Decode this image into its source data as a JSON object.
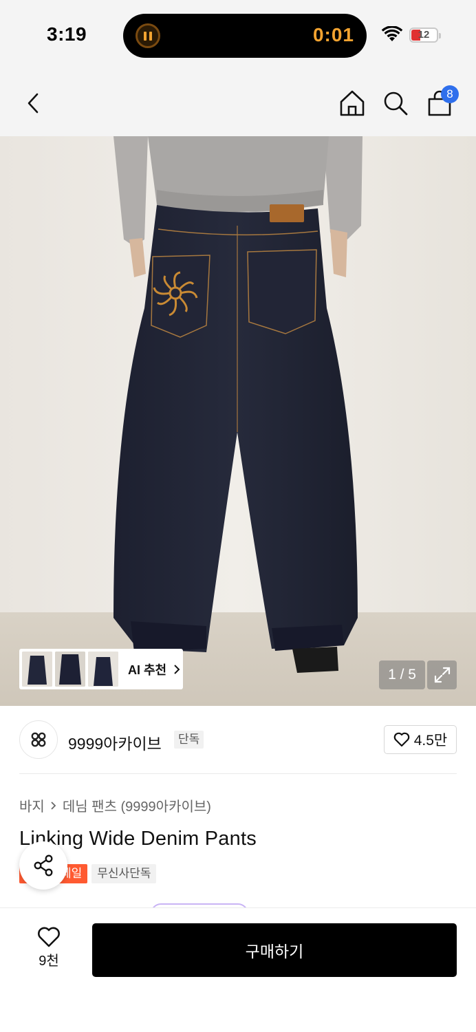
{
  "status_bar": {
    "time": "3:19",
    "timer": "0:01",
    "battery": "12"
  },
  "nav": {
    "icons": [
      "back-icon",
      "home-icon",
      "search-icon",
      "bag-icon"
    ],
    "cart_count": "8"
  },
  "gallery": {
    "ai_label": "AI 추천",
    "page_counter": "1 / 5",
    "thumbnail_count": 3
  },
  "brand": {
    "name": "9999아카이브",
    "tag": "단독",
    "likes": "4.5만"
  },
  "product": {
    "breadcrumb": [
      "바지",
      "데님 팬츠 (9999아카이브)"
    ],
    "title": "Linking Wide Denim Pants",
    "tags": [
      "세일",
      "무신사단독"
    ]
  },
  "bottom_bar": {
    "wish_count": "9천",
    "buy_label": "구매하기"
  },
  "colors": {
    "accent_blue": "#2f6fec",
    "sale_orange": "#ff5a31",
    "timer_orange": "#f3a330",
    "buy_black": "#000000"
  }
}
